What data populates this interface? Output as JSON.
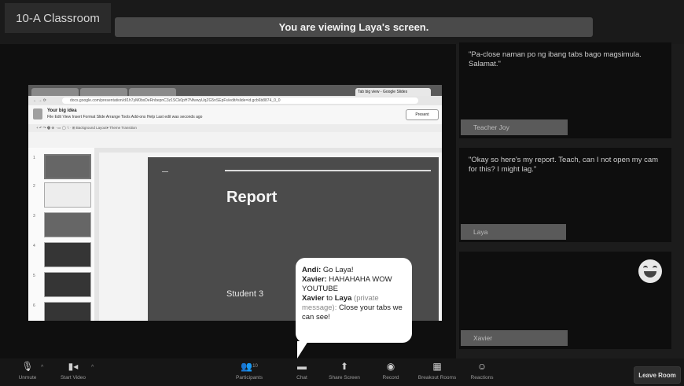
{
  "header": {
    "room_title": "10-A Classroom",
    "banner": "You are viewing Laya's screen."
  },
  "shared_screen": {
    "browser_tabs": [
      "",
      "",
      "",
      "Tab big view - Google Slides"
    ],
    "address": "docs.google.com/presentation/d/1h7yM0bxDeRnbepnC3z1SCk0pH7NfwwyUqZG5nSEpFs/edit#slide=id.gcb6b8874_0_0",
    "doc_title": "Your big idea",
    "menu": "File  Edit  View  Insert  Format  Slide  Arrange  Tools  Add-ons  Help   Last edit was seconds ago",
    "present_label": "Present",
    "toolbar": "+  ↶  ↷  🖶  ⊕  ·  ▭  ◯  ∖  ·  ⊞  Background   Layout▾   Theme   Transition",
    "thumb_numbers": [
      "1",
      "2",
      "3",
      "4",
      "5",
      "6"
    ],
    "slide_title": "Report",
    "slide_subtitle": "Student 3"
  },
  "chat_bubble": {
    "line1_name": "Andi:",
    "line1_text": " Go Laya!",
    "line2_name": "Xavier:",
    "line2_text": " HAHAHAHA WOW YOUTUBE",
    "line3_from": "Xavier",
    "line3_to_word": " to ",
    "line3_to": "Laya",
    "line3_private": " (private message):",
    "line3_text": " Close your tabs we can see!"
  },
  "participants": [
    {
      "message": "\"Pa-close naman po ng ibang tabs bago magsimula. Salamat.\"",
      "name": "Teacher Joy"
    },
    {
      "message": "\"Okay so here's my report. Teach, can I not open my cam for this? I might lag.\"",
      "name": "Laya"
    },
    {
      "message": "",
      "name": "Xavier",
      "reaction": "laughing-emoji"
    }
  ],
  "controls": {
    "unmute": "Unmute",
    "start_video": "Start Video",
    "participants": "Participants",
    "participants_count": "10",
    "chat": "Chat",
    "share_screen": "Share Screen",
    "record": "Record",
    "breakout_rooms": "Breakout Rooms",
    "reactions": "Reactions",
    "leave_room": "Leave Room"
  },
  "colors": {
    "background": "#1c1c1c",
    "banner": "#4a4a4a",
    "slide_bg": "#4b4b4b"
  }
}
